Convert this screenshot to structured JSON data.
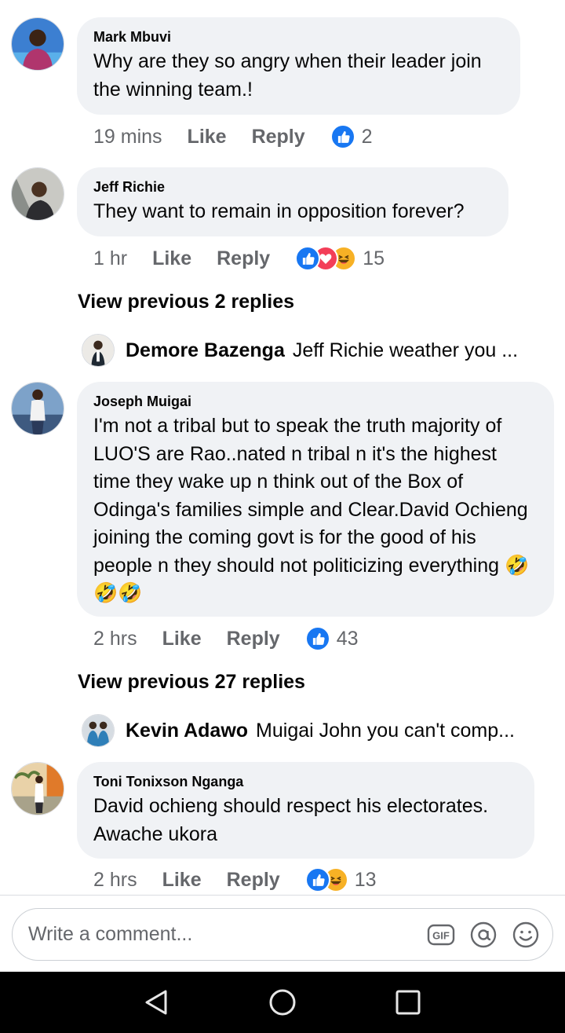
{
  "comments": [
    {
      "author": "Mark Mbuvi",
      "text": "Why are they so angry when their leader join the winning team.!",
      "time": "19 mins",
      "like_label": "Like",
      "reply_label": "Reply",
      "reactions": [
        "like"
      ],
      "reaction_count": "2"
    },
    {
      "author": "Jeff Richie",
      "text": "They want to remain in opposition forever?",
      "time": "1 hr",
      "like_label": "Like",
      "reply_label": "Reply",
      "reactions": [
        "like",
        "love",
        "haha"
      ],
      "reaction_count": "15",
      "view_previous": "View previous 2 replies",
      "latest_reply": {
        "author": "Demore Bazenga",
        "text": "Jeff Richie weather you ..."
      }
    },
    {
      "author": "Joseph Muigai",
      "text": "I'm not a tribal but to speak the truth majority of LUO'S are Rao..nated n tribal n it's the highest time they wake up n think out of the Box of Odinga's families simple and Clear.David Ochieng joining the coming govt is for the good of his people n they should not politicizing everything",
      "emoji": "🤣🤣🤣",
      "time": "2 hrs",
      "like_label": "Like",
      "reply_label": "Reply",
      "reactions": [
        "like"
      ],
      "reaction_count": "43",
      "view_previous": "View previous 27 replies",
      "latest_reply": {
        "author": "Kevin Adawo",
        "text": "Muigai John you can't comp..."
      }
    },
    {
      "author": "Toni Tonixson Nganga",
      "text": "David ochieng should respect his electorates. Awache ukora",
      "time": "2 hrs",
      "like_label": "Like",
      "reply_label": "Reply",
      "reactions": [
        "like",
        "haha"
      ],
      "reaction_count": "13"
    }
  ],
  "composer": {
    "placeholder": "Write a comment...",
    "gif_label": "GIF",
    "icons": [
      "gif-icon",
      "mention-icon",
      "emoji-icon"
    ]
  },
  "navbar": {
    "icons": [
      "back-icon",
      "home-icon",
      "recents-icon"
    ]
  },
  "colors": {
    "like": "#1877f2",
    "love": "#f33e58",
    "haha": "#f7b125",
    "bubble": "#f0f2f5",
    "meta": "#65676b"
  }
}
